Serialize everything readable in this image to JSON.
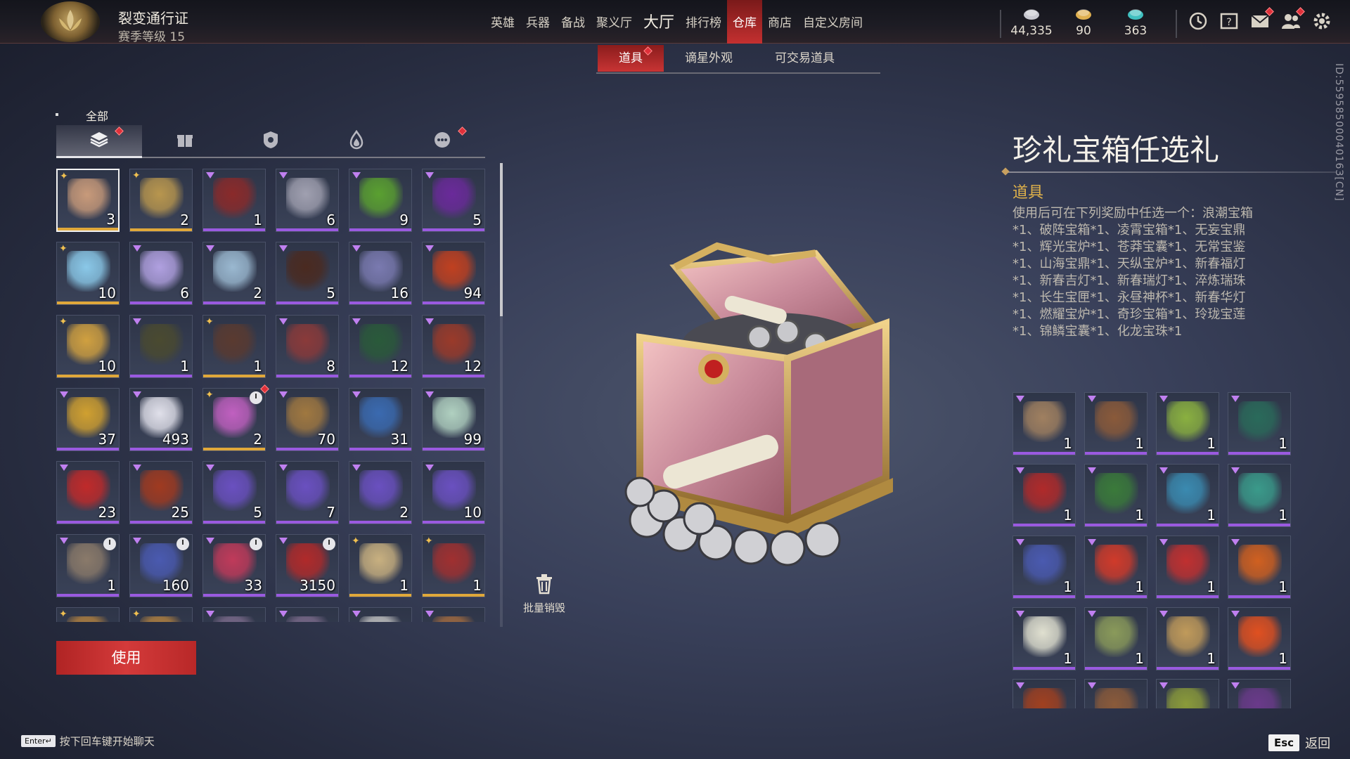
{
  "header": {
    "pass_title": "裂变通行证",
    "pass_level": "赛季等级 15",
    "nav": [
      {
        "label": "英雄",
        "dot": true,
        "big": false,
        "active": false
      },
      {
        "label": "兵器",
        "dot": false,
        "big": false,
        "active": false
      },
      {
        "label": "备战",
        "dot": false,
        "big": false,
        "active": false
      },
      {
        "label": "聚义厅",
        "dot": true,
        "big": false,
        "active": false
      },
      {
        "label": "大厅",
        "dot": false,
        "big": true,
        "active": false
      },
      {
        "label": "排行榜",
        "dot": false,
        "big": false,
        "active": false
      },
      {
        "label": "仓库",
        "dot": true,
        "big": false,
        "active": true
      },
      {
        "label": "商店",
        "dot": true,
        "big": false,
        "active": false
      },
      {
        "label": "自定义房间",
        "dot": false,
        "big": false,
        "active": false
      }
    ],
    "currencies": [
      {
        "icon": "silver-coins-icon",
        "value": "44,335"
      },
      {
        "icon": "gold-ingot-icon",
        "value": "90"
      },
      {
        "icon": "jade-feather-icon",
        "value": "363"
      }
    ],
    "system_icons": [
      {
        "name": "history-icon",
        "dot": false
      },
      {
        "name": "help-icon",
        "dot": false
      },
      {
        "name": "mail-icon",
        "dot": true
      },
      {
        "name": "friends-icon",
        "dot": true
      },
      {
        "name": "settings-icon",
        "dot": false
      }
    ]
  },
  "subtabs": [
    {
      "label": "道具",
      "active": true,
      "dot": true
    },
    {
      "label": "谪星外观",
      "active": false,
      "dot": false
    },
    {
      "label": "可交易道具",
      "active": false,
      "dot": false
    }
  ],
  "category": {
    "label": "全部",
    "tabs": [
      {
        "icon": "layers-icon",
        "active": true,
        "dot": true
      },
      {
        "icon": "gift-icon",
        "active": false,
        "dot": false
      },
      {
        "icon": "badge-icon",
        "active": false,
        "dot": false
      },
      {
        "icon": "flame-icon",
        "active": false,
        "dot": false
      },
      {
        "icon": "more-icon",
        "active": false,
        "dot": true
      }
    ]
  },
  "inventory": [
    {
      "qty": "3",
      "rarity": "gold",
      "mark": "star",
      "color": "#c89a7a",
      "selected": true
    },
    {
      "qty": "2",
      "rarity": "gold",
      "mark": "star",
      "color": "#b8964e"
    },
    {
      "qty": "1",
      "rarity": "purple",
      "mark": "tri",
      "color": "#8a2a2a"
    },
    {
      "qty": "6",
      "rarity": "purple",
      "mark": "tri",
      "color": "#a0a0b0"
    },
    {
      "qty": "9",
      "rarity": "purple",
      "mark": "tri",
      "color": "#5aa030"
    },
    {
      "qty": "5",
      "rarity": "purple",
      "mark": "tri",
      "color": "#6a2a9a"
    },
    {
      "qty": "10",
      "rarity": "gold",
      "mark": "star",
      "color": "#8ac8e8"
    },
    {
      "qty": "6",
      "rarity": "purple",
      "mark": "tri",
      "color": "#b0a0e0"
    },
    {
      "qty": "2",
      "rarity": "purple",
      "mark": "tri",
      "color": "#9ab8d0"
    },
    {
      "qty": "5",
      "rarity": "purple",
      "mark": "tri",
      "color": "#4a2a20"
    },
    {
      "qty": "16",
      "rarity": "purple",
      "mark": "tri",
      "color": "#7a7ab0"
    },
    {
      "qty": "94",
      "rarity": "purple",
      "mark": "tri",
      "color": "#c04020"
    },
    {
      "qty": "10",
      "rarity": "gold",
      "mark": "star",
      "color": "#d0a040"
    },
    {
      "qty": "1",
      "rarity": "purple",
      "mark": "tri",
      "color": "#4a4a30"
    },
    {
      "qty": "1",
      "rarity": "gold",
      "mark": "star",
      "color": "#5a3a30"
    },
    {
      "qty": "8",
      "rarity": "purple",
      "mark": "tri",
      "color": "#8a3a3a"
    },
    {
      "qty": "12",
      "rarity": "purple",
      "mark": "tri",
      "color": "#2a5a3a"
    },
    {
      "qty": "12",
      "rarity": "purple",
      "mark": "tri",
      "color": "#9a3a2a"
    },
    {
      "qty": "37",
      "rarity": "purple",
      "mark": "tri",
      "color": "#d0a030"
    },
    {
      "qty": "493",
      "rarity": "purple",
      "mark": "tri",
      "color": "#e0e0ea"
    },
    {
      "qty": "2",
      "rarity": "gold",
      "mark": "star",
      "color": "#c060c0",
      "clock": true,
      "dot": true
    },
    {
      "qty": "70",
      "rarity": "purple",
      "mark": "tri",
      "color": "#a07840"
    },
    {
      "qty": "31",
      "rarity": "purple",
      "mark": "tri",
      "color": "#3a6ab0"
    },
    {
      "qty": "99",
      "rarity": "purple",
      "mark": "tri",
      "color": "#b0d0c0"
    },
    {
      "qty": "23",
      "rarity": "purple",
      "mark": "tri",
      "color": "#c02a2a"
    },
    {
      "qty": "25",
      "rarity": "purple",
      "mark": "tri",
      "color": "#a03a20"
    },
    {
      "qty": "5",
      "rarity": "purple",
      "mark": "tri",
      "color": "#6a50c0"
    },
    {
      "qty": "7",
      "rarity": "purple",
      "mark": "tri",
      "color": "#6a50c0"
    },
    {
      "qty": "2",
      "rarity": "purple",
      "mark": "tri",
      "color": "#6a50c0"
    },
    {
      "qty": "10",
      "rarity": "purple",
      "mark": "tri",
      "color": "#6a50c0"
    },
    {
      "qty": "1",
      "rarity": "purple",
      "mark": "tri",
      "color": "#8a7a6a",
      "clock": true
    },
    {
      "qty": "160",
      "rarity": "purple",
      "mark": "tri",
      "color": "#4a5ab0",
      "clock": true
    },
    {
      "qty": "33",
      "rarity": "purple",
      "mark": "tri",
      "color": "#c03a5a",
      "clock": true
    },
    {
      "qty": "3150",
      "rarity": "purple",
      "mark": "tri",
      "color": "#b02a2a",
      "clock": true
    },
    {
      "qty": "1",
      "rarity": "gold",
      "mark": "star",
      "color": "#c8b080"
    },
    {
      "qty": "1",
      "rarity": "gold",
      "mark": "star",
      "color": "#a03030"
    },
    {
      "qty": "",
      "rarity": "gold",
      "mark": "star",
      "color": "#b08040"
    },
    {
      "qty": "",
      "rarity": "gold",
      "mark": "star",
      "color": "#b08040"
    },
    {
      "qty": "",
      "rarity": "purple",
      "mark": "tri",
      "color": "#7a6a8a"
    },
    {
      "qty": "",
      "rarity": "purple",
      "mark": "tri",
      "color": "#7a6a8a"
    },
    {
      "qty": "",
      "rarity": "purple",
      "mark": "tri",
      "color": "#c0c0c0"
    },
    {
      "qty": "",
      "rarity": "purple",
      "mark": "tri",
      "color": "#a06a40"
    }
  ],
  "use_button": "使用",
  "destroy_label": "批量销毁",
  "detail": {
    "title": "珍礼宝箱任选礼",
    "category": "道具",
    "description_lines": [
      "使用后可在下列奖励中任选一个：浪潮宝箱",
      "*1、破阵宝箱*1、凌霄宝箱*1、无妄宝鼎",
      "*1、辉光宝炉*1、苍莽宝囊*1、无常宝鉴",
      "*1、山海宝鼎*1、天纵宝炉*1、新春福灯",
      "*1、新春吉灯*1、新春瑞灯*1、淬炼瑞珠",
      "*1、长生宝匣*1、永昼神杯*1、新春华灯",
      "*1、燃耀宝炉*1、奇珍宝箱*1、玲珑宝莲",
      "*1、锦鳞宝囊*1、化龙宝珠*1"
    ],
    "id_text": "ID:5595850004016З[CN]"
  },
  "rewards": [
    {
      "qty": "1",
      "color": "#a08060"
    },
    {
      "qty": "1",
      "color": "#8a5a3a"
    },
    {
      "qty": "1",
      "color": "#8ab040"
    },
    {
      "qty": "1",
      "color": "#2a6a5a"
    },
    {
      "qty": "1",
      "color": "#b02a2a"
    },
    {
      "qty": "1",
      "color": "#3a7a3a"
    },
    {
      "qty": "1",
      "color": "#3a8ab0"
    },
    {
      "qty": "1",
      "color": "#3a9a8a"
    },
    {
      "qty": "1",
      "color": "#4a5ab0"
    },
    {
      "qty": "1",
      "color": "#d03a2a"
    },
    {
      "qty": "1",
      "color": "#c03030"
    },
    {
      "qty": "1",
      "color": "#d06020"
    },
    {
      "qty": "1",
      "color": "#e0e0d0"
    },
    {
      "qty": "1",
      "color": "#8a9a5a"
    },
    {
      "qty": "1",
      "color": "#c09a5a"
    },
    {
      "qty": "1",
      "color": "#e05020"
    },
    {
      "qty": "",
      "color": "#a04020"
    },
    {
      "qty": "",
      "color": "#8a5a3a"
    },
    {
      "qty": "",
      "color": "#8a9a3a"
    },
    {
      "qty": "",
      "color": "#6a3a8a"
    }
  ],
  "hints": {
    "chat_key": "Enter↵",
    "chat_text": "按下回车键开始聊天",
    "back_key": "Esc",
    "back_text": "返回"
  }
}
